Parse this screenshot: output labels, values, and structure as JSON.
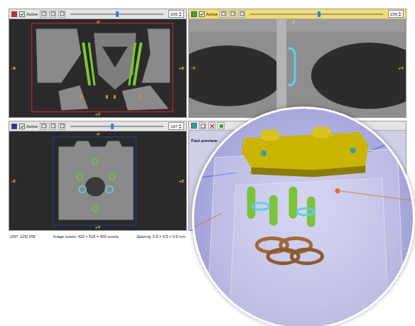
{
  "views": [
    {
      "active_label": "Active",
      "active": true,
      "selected": false,
      "slice": "205",
      "level": 0.5,
      "color": "#d42a2a",
      "axes": {
        "top": "-Y",
        "bottom": "+Y",
        "left": "-X",
        "right": "+X"
      }
    },
    {
      "active_label": "Active",
      "active": true,
      "selected": true,
      "slice": "236",
      "level": 0.52,
      "color": "#3aa33a",
      "axes": {
        "top": "-Z",
        "left": "-Y",
        "right": "+Y"
      }
    },
    {
      "active_label": "Active",
      "active": true,
      "selected": false,
      "slice": "197",
      "level": 0.45,
      "color": "#2a3a9a",
      "axes": {
        "top": "-Y",
        "bottom": "+Y",
        "left": "-Z",
        "right": "+Z"
      }
    }
  ],
  "preview": {
    "label": "Fast preview"
  },
  "status_bar": {
    "position": "(297, 125) 256",
    "extent": "Image extent: 420 × 515 × 405 voxels",
    "spacing": "Spacing: 0.5 × 0.5 × 0.5 mm"
  }
}
